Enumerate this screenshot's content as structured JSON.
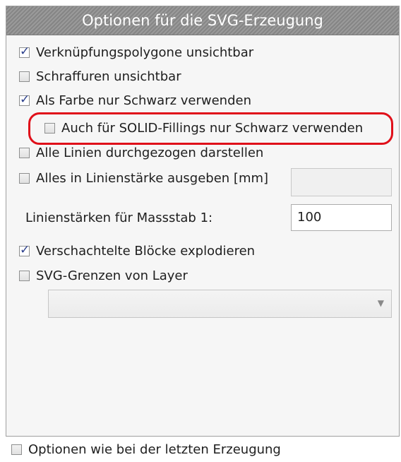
{
  "panel": {
    "title": "Optionen für die SVG-Erzeugung",
    "options": [
      {
        "label": "Verknüpfungspolygone unsichtbar",
        "checked": true
      },
      {
        "label": "Schraffuren unsichtbar",
        "checked": false
      },
      {
        "label": "Als Farbe nur Schwarz verwenden",
        "checked": true
      },
      {
        "label": "Auch für SOLID-Fillings nur Schwarz verwenden",
        "checked": false
      },
      {
        "label": "Alle Linien durchgezogen darstellen",
        "checked": false
      },
      {
        "label": "Alles in Linienstärke ausgeben [mm]",
        "checked": false
      },
      {
        "label": "Verschachtelte Blöcke explodieren",
        "checked": true
      },
      {
        "label": "SVG-Grenzen von Layer",
        "checked": false
      }
    ],
    "line_width_field": {
      "value": ""
    },
    "scale_label": "Linienstärken für Massstab 1:",
    "scale_value": "100",
    "layer_select": {
      "value": ""
    }
  },
  "footer": {
    "label": "Optionen wie bei der letzten Erzeugung",
    "checked": false
  },
  "colors": {
    "highlight": "#e0101a",
    "checkmark": "#2b3f8c"
  }
}
